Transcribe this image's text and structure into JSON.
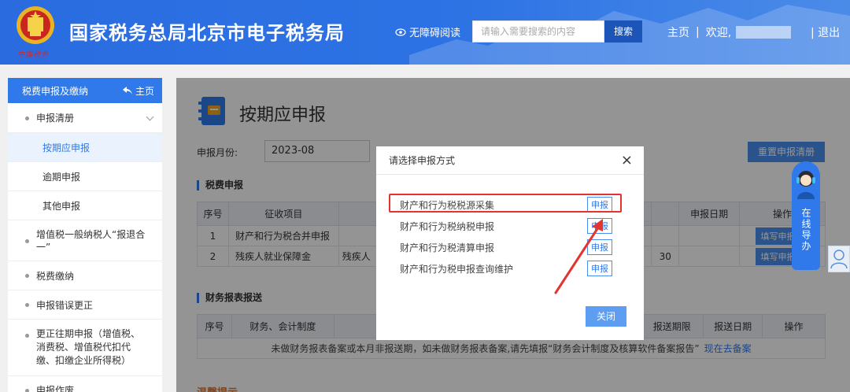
{
  "header": {
    "title": "国家税务总局北京市电子税务局",
    "emblem_caption": "中国税务",
    "a11y_label": "无障碍阅读",
    "search_placeholder": "请输入需要搜索的内容",
    "search_button": "搜索",
    "nav_home": "主页",
    "nav_welcome": "欢迎,",
    "nav_logout": "退出",
    "sep": "|"
  },
  "sidebar": {
    "title": "税费申报及缴纳",
    "home_label": "主页",
    "items": {
      "declare_list": "申报清册",
      "sub_period": "按期应申报",
      "sub_overdue": "逾期申报",
      "sub_other": "其他申报",
      "vat": "增值税一般纳税人“报退合一”",
      "pay": "税费缴纳",
      "correct": "申报错误更正",
      "correct_prior": "更正往期申报（增值税、消费税、增值税代扣代缴、扣缴企业所得税）",
      "void": "申报作废"
    }
  },
  "main": {
    "page_title": "按期应申报",
    "month_label": "申报月份:",
    "month_value": "2023-08",
    "reset_button": "重置申报清册",
    "section_tax": "税费申报",
    "tax_headers": {
      "no": "序号",
      "item": "征收项目",
      "date": "申报日期",
      "op": "操作"
    },
    "tax_rows": [
      {
        "no": "1",
        "item": "财产和行为税合并申报",
        "extra": "",
        "deadline": "",
        "date": "",
        "op": "填写申报表"
      },
      {
        "no": "2",
        "item": "残疾人就业保障金",
        "extra": "残疾人",
        "deadline": "30",
        "date": "",
        "op": "填写申报表"
      }
    ],
    "section_finance": "财务报表报送",
    "fin_headers": {
      "no": "序号",
      "system": "财务、会计制度",
      "deadline": "报送期限",
      "date": "报送日期",
      "op": "操作"
    },
    "fin_note": "未做财务报表备案或本月非报送期，如未做财务报表备案,请先填报“财务会计制度及核算软件备案报告”",
    "fin_note_link": "现在去备案",
    "warm_tip": "温馨提示"
  },
  "help_widget": {
    "label": "在线导办"
  },
  "modal": {
    "title": "请选择申报方式",
    "options": [
      {
        "label": "财产和行为税税源采集",
        "button": "申报"
      },
      {
        "label": "财产和行为税纳税申报",
        "button": "申报"
      },
      {
        "label": "财产和行为税清算申报",
        "button": "申报"
      },
      {
        "label": "财产和行为税申报查询维护",
        "button": "申报"
      }
    ],
    "close_button": "关闭"
  },
  "colors": {
    "primary": "#2f79ea",
    "header": "#2a6ce0",
    "highlight": "#e3342f"
  }
}
